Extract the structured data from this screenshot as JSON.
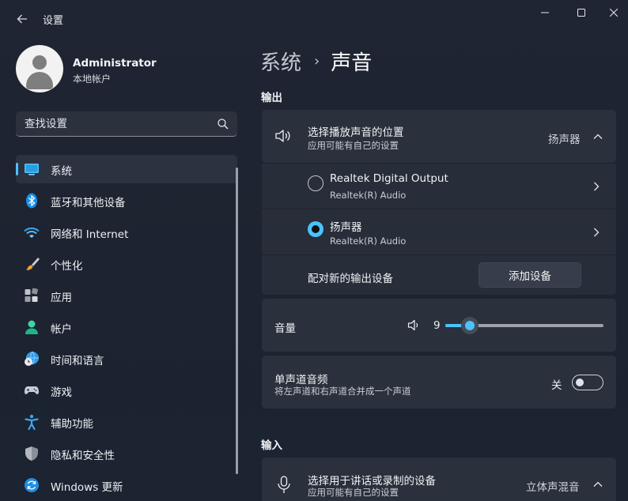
{
  "window": {
    "title": "设置",
    "controls": {
      "minimize": "minimize-icon",
      "maximize": "maximize-icon",
      "close": "close-icon"
    }
  },
  "profile": {
    "name": "Administrator",
    "account_type": "本地帐户"
  },
  "search": {
    "placeholder": "查找设置",
    "icon": "search-icon"
  },
  "nav": [
    {
      "label": "系统",
      "icon": "monitor-icon",
      "active": true
    },
    {
      "label": "蓝牙和其他设备",
      "icon": "bluetooth-icon",
      "active": false
    },
    {
      "label": "网络和 Internet",
      "icon": "wifi-icon",
      "active": false
    },
    {
      "label": "个性化",
      "icon": "brush-icon",
      "active": false
    },
    {
      "label": "应用",
      "icon": "apps-icon",
      "active": false
    },
    {
      "label": "帐户",
      "icon": "account-icon",
      "active": false
    },
    {
      "label": "时间和语言",
      "icon": "globe-clock-icon",
      "active": false
    },
    {
      "label": "游戏",
      "icon": "gamepad-icon",
      "active": false
    },
    {
      "label": "辅助功能",
      "icon": "accessibility-icon",
      "active": false
    },
    {
      "label": "隐私和安全性",
      "icon": "shield-icon",
      "active": false
    },
    {
      "label": "Windows 更新",
      "icon": "update-icon",
      "active": false
    }
  ],
  "breadcrumb": {
    "parent": "系统",
    "separator": "›",
    "current": "声音"
  },
  "output": {
    "section_title": "输出",
    "choose_device": {
      "title": "选择播放声音的位置",
      "subtitle": "应用可能有自己的设置",
      "value": "扬声器",
      "expanded": true
    },
    "devices": [
      {
        "name": "Realtek Digital Output",
        "driver": "Realtek(R) Audio",
        "selected": false
      },
      {
        "name": "扬声器",
        "driver": "Realtek(R) Audio",
        "selected": true
      }
    ],
    "pair": {
      "label": "配对新的输出设备",
      "button": "添加设备"
    },
    "volume": {
      "label": "音量",
      "value": "9",
      "level": 0.09
    },
    "mono": {
      "title": "单声道音频",
      "subtitle": "将左声道和右声道合并成一个声道",
      "state": "关",
      "on": false
    }
  },
  "input": {
    "section_title": "输入",
    "choose_device": {
      "title": "选择用于讲话或录制的设备",
      "subtitle": "应用可能有自己的设置",
      "value": "立体声混音"
    }
  },
  "colors": {
    "accent": "#4cc2ff",
    "background": "#1f2532",
    "card": "#2a303c"
  }
}
